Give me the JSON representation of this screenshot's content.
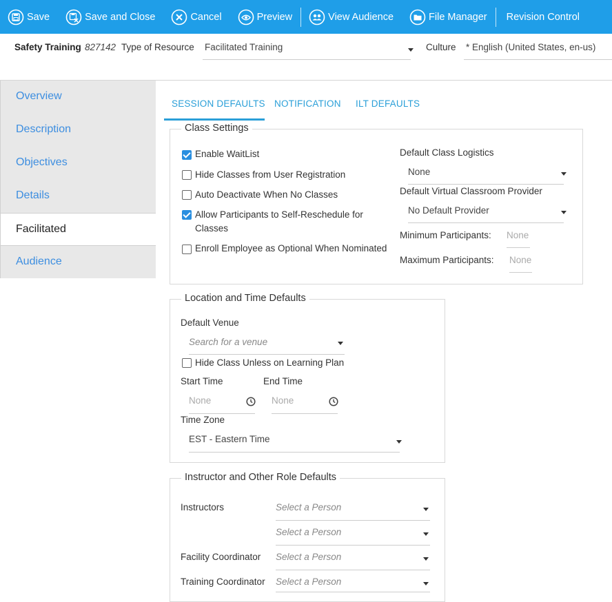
{
  "toolbar": {
    "save": "Save",
    "save_close": "Save and Close",
    "cancel": "Cancel",
    "preview": "Preview",
    "view_audience": "View Audience",
    "file_manager": "File Manager",
    "revision_control": "Revision Control"
  },
  "header": {
    "title": "Safety Training",
    "id": "827142",
    "type_label": "Type of Resource",
    "type_value": "Facilitated Training",
    "culture_label": "Culture",
    "culture_value": "* English (United States, en-us)"
  },
  "sidebar": [
    {
      "label": "Overview",
      "active": false
    },
    {
      "label": "Description",
      "active": false
    },
    {
      "label": "Objectives",
      "active": false
    },
    {
      "label": "Details",
      "active": false
    },
    {
      "label": "Facilitated",
      "active": true
    },
    {
      "label": "Audience",
      "active": false
    }
  ],
  "tabs": [
    "SESSION DEFAULTS",
    "NOTIFICATION",
    "ILT DEFAULTS"
  ],
  "class_settings": {
    "legend": "Class Settings",
    "checkboxes": [
      {
        "label": "Enable WaitList",
        "checked": true
      },
      {
        "label": "Hide Classes from User Registration",
        "checked": false
      },
      {
        "label": "Auto Deactivate When No Classes",
        "checked": false
      },
      {
        "label": "Allow Participants to Self-Reschedule for",
        "label2": "Classes",
        "checked": true
      },
      {
        "label": "Enroll Employee as Optional When Nominated",
        "checked": false
      }
    ],
    "logistics_label": "Default Class Logistics",
    "logistics_value": "None",
    "vcp_label": "Default Virtual Classroom Provider",
    "vcp_value": "No Default Provider",
    "min_label": "Minimum Participants:",
    "min_placeholder": "None",
    "max_label": "Maximum Participants:",
    "max_placeholder": "None"
  },
  "location": {
    "legend": "Location and Time Defaults",
    "venue_label": "Default Venue",
    "venue_placeholder": "Search for a venue",
    "hide_class_label": "Hide Class Unless on Learning Plan",
    "start_label": "Start Time",
    "end_label": "End Time",
    "start_placeholder": "None",
    "end_placeholder": "None",
    "tz_label": "Time Zone",
    "tz_value": "EST - Eastern Time"
  },
  "instructor": {
    "legend": "Instructor and Other Role Defaults",
    "instructors_label": "Instructors",
    "facility_label": "Facility Coordinator",
    "training_label": "Training Coordinator",
    "select_placeholder": "Select a Person"
  },
  "colors": {
    "toolbar": "#1f9ee8",
    "accent": "#2a9fd8",
    "sidebar_bg": "#e8e8e8",
    "sidebar_link": "#3d8ee0"
  }
}
